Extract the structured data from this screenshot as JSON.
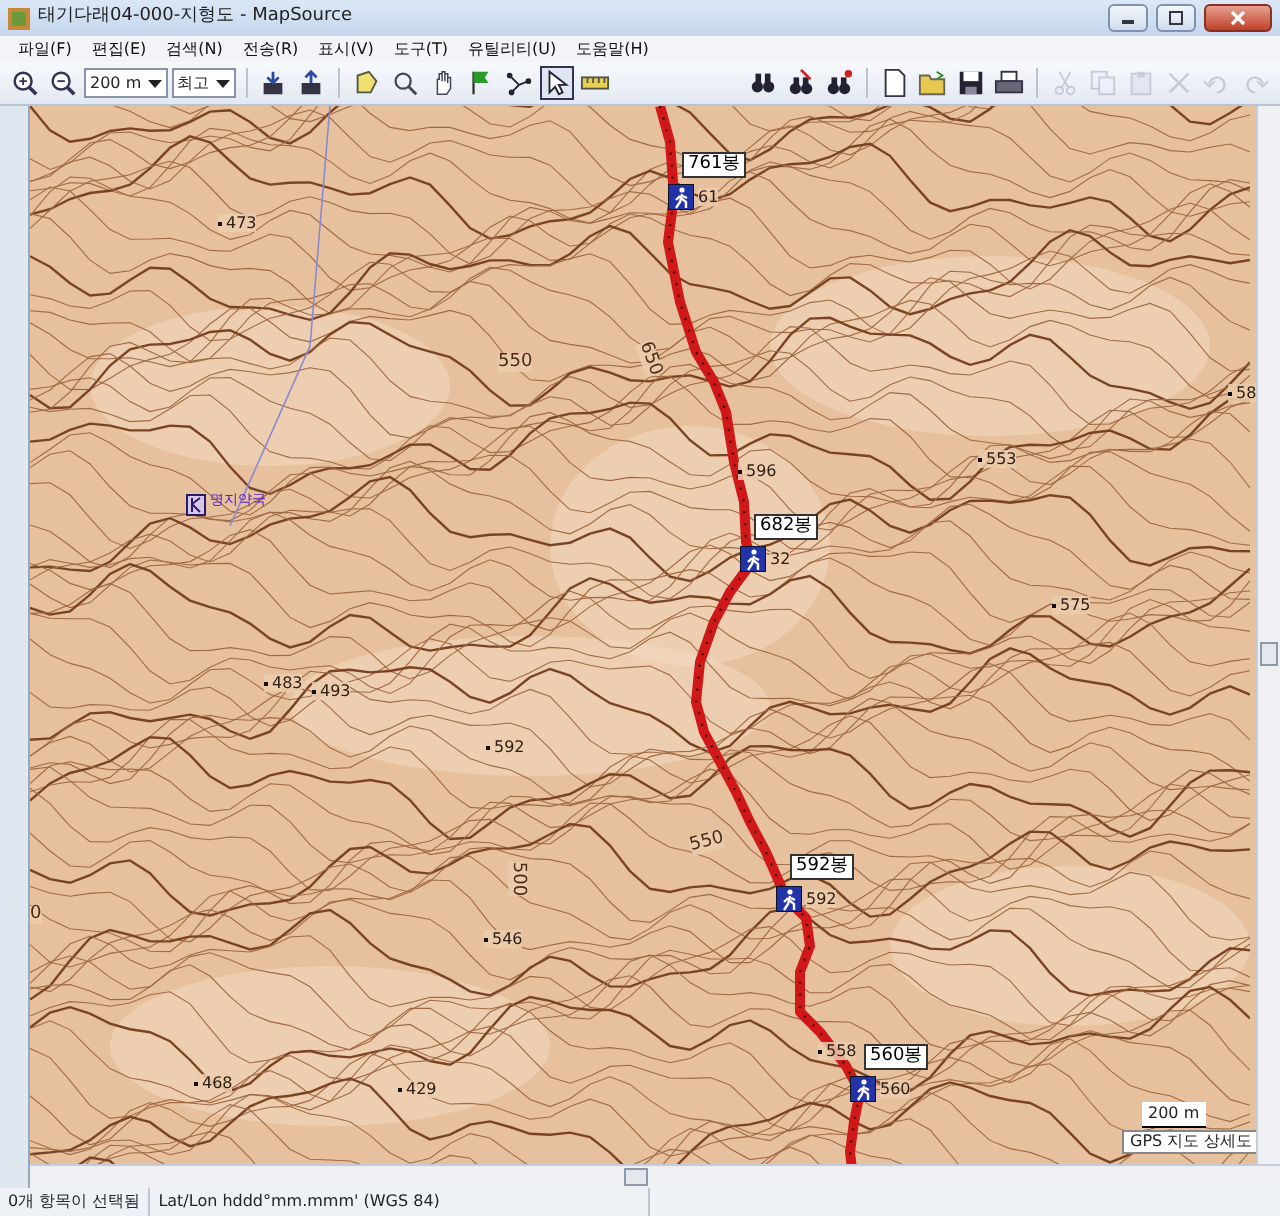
{
  "window": {
    "title": "태기다래04-000-지형도 - MapSource"
  },
  "menu": [
    {
      "label": "파일(F)"
    },
    {
      "label": "편집(E)"
    },
    {
      "label": "검색(N)"
    },
    {
      "label": "전송(R)"
    },
    {
      "label": "표시(V)"
    },
    {
      "label": "도구(T)"
    },
    {
      "label": "유틸리티(U)"
    },
    {
      "label": "도움말(H)"
    }
  ],
  "toolbar": [
    {
      "kind": "zoom-in",
      "selected": false,
      "disabled": false
    },
    {
      "kind": "zoom-out",
      "selected": false,
      "disabled": false
    },
    {
      "kind": "select",
      "value": "200 m",
      "disabled": false
    },
    {
      "kind": "select",
      "value": "최고",
      "disabled": false
    },
    {
      "kind": "separator"
    },
    {
      "kind": "receive",
      "selected": false,
      "disabled": false
    },
    {
      "kind": "send",
      "selected": false,
      "disabled": false
    },
    {
      "kind": "separator"
    },
    {
      "kind": "area",
      "selected": false,
      "disabled": false
    },
    {
      "kind": "zoom-tool",
      "selected": false,
      "disabled": false
    },
    {
      "kind": "hand",
      "selected": false,
      "disabled": false
    },
    {
      "kind": "flag",
      "selected": false,
      "disabled": false
    },
    {
      "kind": "route",
      "selected": false,
      "disabled": false
    },
    {
      "kind": "pointer",
      "selected": true,
      "disabled": false
    },
    {
      "kind": "ruler",
      "selected": false,
      "disabled": false
    },
    {
      "kind": "spacer"
    },
    {
      "kind": "find",
      "selected": false,
      "disabled": false
    },
    {
      "kind": "find-places",
      "selected": false,
      "disabled": false
    },
    {
      "kind": "find-near",
      "selected": false,
      "disabled": false
    },
    {
      "kind": "separator"
    },
    {
      "kind": "new",
      "selected": false,
      "disabled": false
    },
    {
      "kind": "open",
      "selected": false,
      "disabled": false
    },
    {
      "kind": "save",
      "selected": false,
      "disabled": false
    },
    {
      "kind": "print",
      "selected": false,
      "disabled": false
    },
    {
      "kind": "separator"
    },
    {
      "kind": "cut",
      "selected": false,
      "disabled": true
    },
    {
      "kind": "copy",
      "selected": false,
      "disabled": true
    },
    {
      "kind": "paste",
      "selected": false,
      "disabled": true
    },
    {
      "kind": "delete",
      "selected": false,
      "disabled": true
    },
    {
      "kind": "undo",
      "selected": false,
      "disabled": true
    },
    {
      "kind": "redo",
      "selected": false,
      "disabled": true
    }
  ],
  "map": {
    "waypoints": [
      {
        "name": "761봉",
        "elevation": "61"
      },
      {
        "name": "682봉",
        "elevation": "32"
      },
      {
        "name": "592봉",
        "elevation": "592"
      },
      {
        "name": "560봉",
        "elevation": "560"
      }
    ],
    "spot_heights": [
      {
        "label": "473"
      },
      {
        "label": "596"
      },
      {
        "label": "553"
      },
      {
        "label": "58"
      },
      {
        "label": "575"
      },
      {
        "label": "483"
      },
      {
        "label": "493"
      },
      {
        "label": "592"
      },
      {
        "label": "546"
      },
      {
        "label": "558"
      },
      {
        "label": "468"
      },
      {
        "label": "429"
      }
    ],
    "contour_labels": [
      {
        "label": "550"
      },
      {
        "label": "650"
      },
      {
        "label": "550"
      },
      {
        "label": "500"
      },
      {
        "label": "0"
      }
    ],
    "poi": {
      "name": "명지약국"
    },
    "scale": {
      "label": "200 m"
    },
    "map_name": "GPS 지도 상세도"
  },
  "status_bar": [
    {
      "text": "0개 항목이 선택됨"
    },
    {
      "text": "Lat/Lon hddd°mm.mmm' (WGS 84)"
    }
  ]
}
